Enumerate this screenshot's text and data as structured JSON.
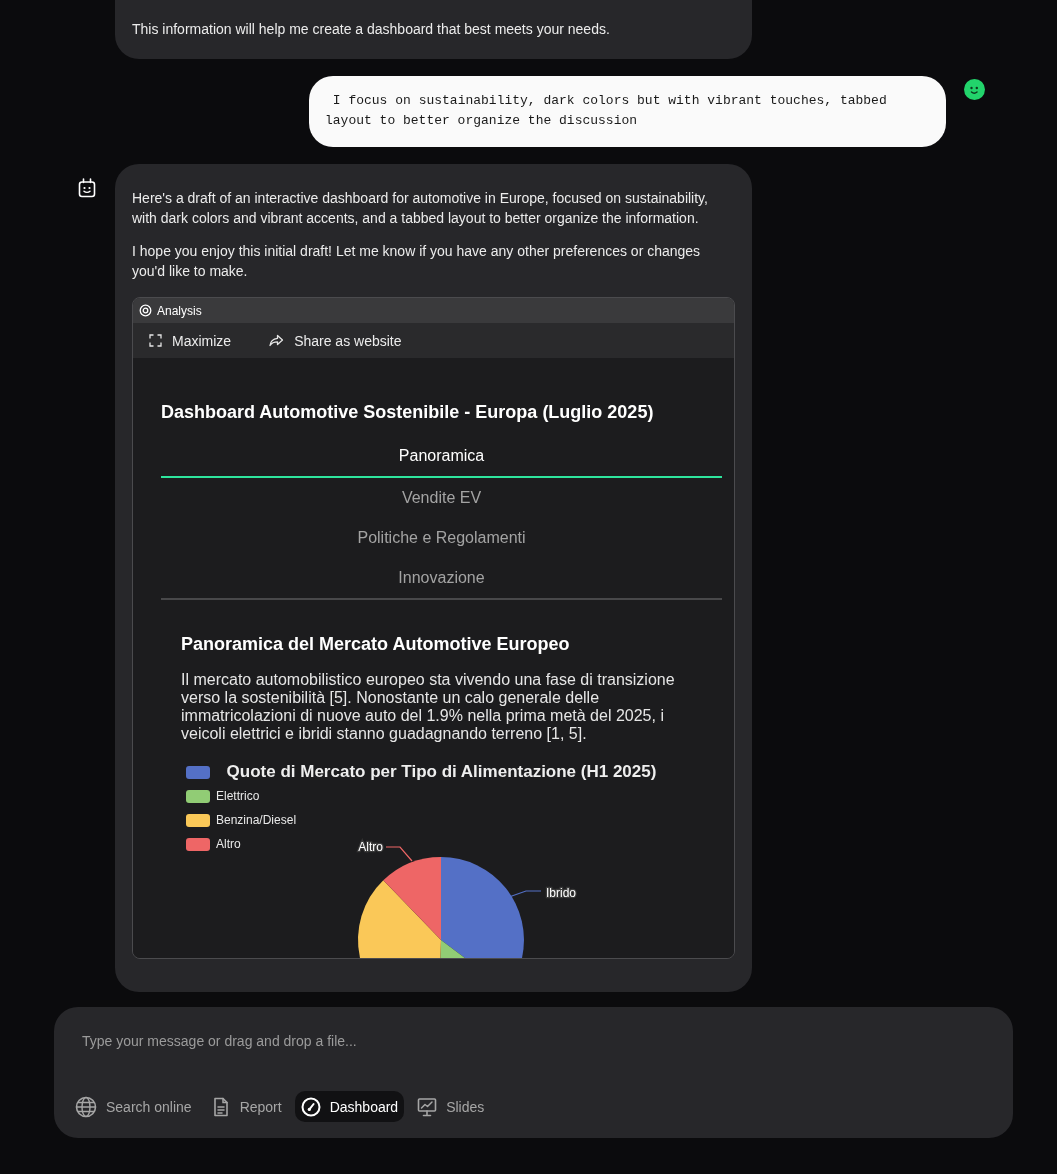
{
  "messages": [
    {
      "kind": "assistant",
      "avatar": false,
      "paragraphs": [
        "This information will help me create a dashboard that best meets your needs."
      ]
    },
    {
      "kind": "user",
      "avatar": true,
      "text": " I focus on sustainability, dark colors but with vibrant touches, tabbed layout to better organize the discussion"
    },
    {
      "kind": "assistant",
      "avatar": true,
      "paragraphs": [
        "Here's a draft of an interactive dashboard for automotive in Europe, focused on sustainability, with dark colors and vibrant accents, and a tabbed layout to better organize the information.",
        "I hope you enjoy this initial draft! Let me know if you have any other preferences or changes you'd like to make."
      ],
      "artifact": {
        "label": "Analysis",
        "actions": [
          {
            "kind": "maximize",
            "label": "Maximize"
          },
          {
            "kind": "share",
            "label": "Share as website"
          }
        ],
        "dashboard": {
          "title": "Dashboard Automotive Sostenibile - Europa (Luglio 2025)",
          "tabs": [
            {
              "label": "Panoramica",
              "selected": true
            },
            {
              "label": "Vendite EV",
              "selected": false
            },
            {
              "label": "Politiche e Regolamenti",
              "selected": false
            },
            {
              "label": "Innovazione",
              "selected": false
            }
          ],
          "section": {
            "title": "Panoramica del Mercato Automotive Europeo",
            "text": "Il mercato automobilistico europeo sta vivendo una fase di transizione verso la sostenibilità [5]. Nonostante un calo generale delle immatricolazioni di nuove auto del 1.9% nella prima metà del 2025, i veicoli elettrici e ibridi stanno guadagnando terreno [1, 5].",
            "chart": {
              "title": "Quote di Mercato per Tipo di Alimentazione (H1 2025)",
              "legend": [
                {
                  "color": "#5470c6",
                  "slice_label": "Ibrido"
                },
                {
                  "label": "Elettrico",
                  "color": "#91cc75"
                },
                {
                  "label": "Benzina/Diesel",
                  "color": "#fac858"
                },
                {
                  "label": "Altro",
                  "color": "#ee6666",
                  "slice_label": "Altro"
                }
              ]
            }
          }
        }
      }
    }
  ],
  "composer": {
    "placeholder": "Type your message or drag and drop a file...",
    "tools": [
      {
        "kind": "search",
        "label": "Search online",
        "selected": false
      },
      {
        "kind": "report",
        "label": "Report",
        "selected": false
      },
      {
        "kind": "dashboard",
        "label": "Dashboard",
        "selected": true
      },
      {
        "kind": "slides",
        "label": "Slides",
        "selected": false
      }
    ]
  }
}
